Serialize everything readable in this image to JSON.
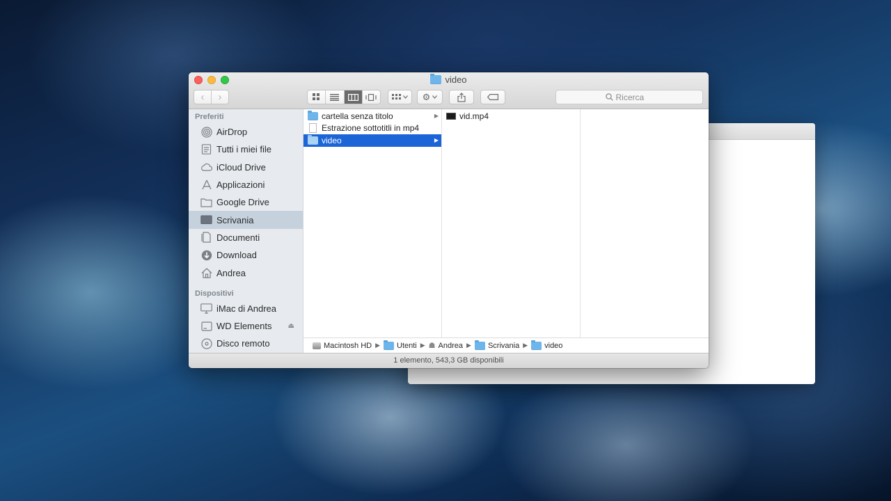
{
  "window": {
    "title": "video"
  },
  "toolbar": {
    "back_glyph": "‹",
    "forward_glyph": "›",
    "search_placeholder": "Ricerca"
  },
  "sidebar": {
    "favorites_header": "Preferiti",
    "favorites": [
      {
        "label": "AirDrop",
        "icon": "airdrop-icon"
      },
      {
        "label": "Tutti i miei file",
        "icon": "all-files-icon"
      },
      {
        "label": "iCloud Drive",
        "icon": "cloud-icon"
      },
      {
        "label": "Applicazioni",
        "icon": "applications-icon"
      },
      {
        "label": "Google Drive",
        "icon": "folder-icon"
      },
      {
        "label": "Scrivania",
        "icon": "desktop-icon",
        "selected": true
      },
      {
        "label": "Documenti",
        "icon": "documents-icon"
      },
      {
        "label": "Download",
        "icon": "download-icon"
      },
      {
        "label": "Andrea",
        "icon": "home-icon"
      }
    ],
    "devices_header": "Dispositivi",
    "devices": [
      {
        "label": "iMac di Andrea",
        "icon": "computer-icon"
      },
      {
        "label": "WD Elements",
        "icon": "drive-icon",
        "eject": true
      },
      {
        "label": "Disco remoto",
        "icon": "disc-icon"
      }
    ]
  },
  "columns": {
    "col1": [
      {
        "label": "cartella senza titolo",
        "type": "folder",
        "has_children": true
      },
      {
        "label": "Estrazione sottotitli in mp4",
        "type": "file",
        "has_children": false
      },
      {
        "label": "video",
        "type": "folder",
        "has_children": true,
        "selected": true
      }
    ],
    "col2": [
      {
        "label": "vid.mp4",
        "type": "video"
      }
    ]
  },
  "pathbar": {
    "segments": [
      "Macintosh HD",
      "Utenti",
      "Andrea",
      "Scrivania",
      "video"
    ]
  },
  "status": {
    "text": "1 elemento, 543,3 GB disponibili"
  },
  "colors": {
    "selection": "#1b65d7",
    "sidebar_selection": "#c5d1dd",
    "folder": "#6db5ea"
  }
}
